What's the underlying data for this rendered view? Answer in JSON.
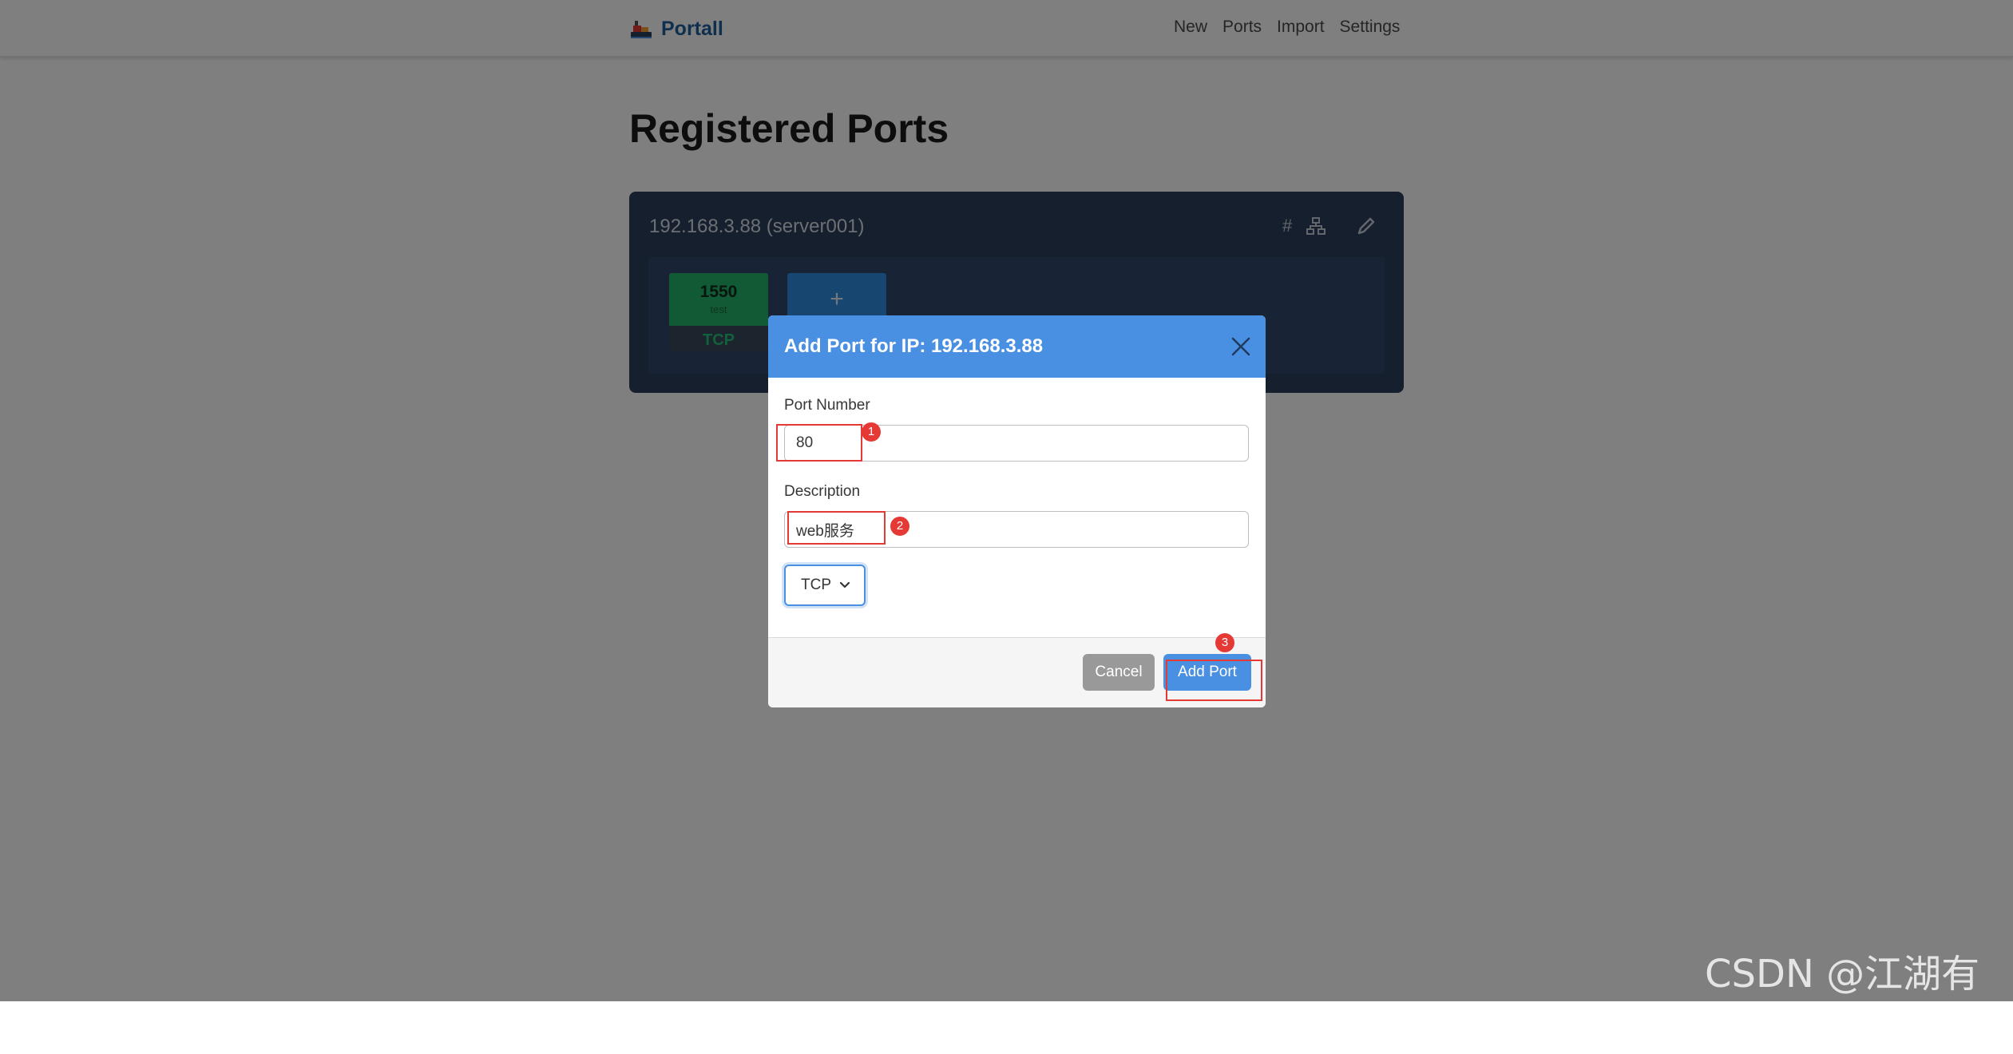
{
  "navbar": {
    "brand": "Portall",
    "links": [
      "New",
      "Ports",
      "Import",
      "Settings"
    ]
  },
  "page": {
    "title": "Registered Ports"
  },
  "ip_card": {
    "header": "192.168.3.88 (server001)",
    "port": {
      "number": "1550",
      "description": "test",
      "protocol": "TCP"
    },
    "add_symbol": "+"
  },
  "modal": {
    "title": "Add Port for IP: 192.168.3.88",
    "port_label": "Port Number",
    "port_value": "80",
    "description_label": "Description",
    "description_value": "web服务",
    "protocol_value": "TCP",
    "cancel_label": "Cancel",
    "add_label": "Add Port"
  },
  "annotations": [
    "1",
    "2",
    "3"
  ],
  "watermark": "CSDN @江湖有缘",
  "colors": {
    "primary": "#4a90e2",
    "card": "#2a3f5a",
    "port_green": "#24b36a",
    "annotation_red": "#e53935"
  }
}
